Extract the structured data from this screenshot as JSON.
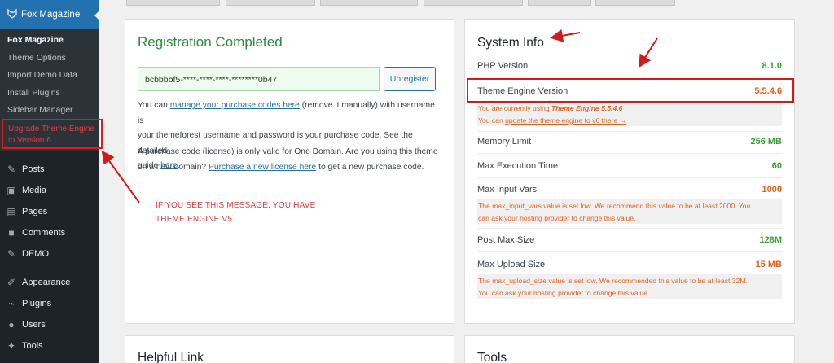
{
  "sidebar": {
    "brand": "Fox Magazine",
    "sub_items": [
      {
        "label": "Fox Magazine",
        "active": true
      },
      {
        "label": "Theme Options"
      },
      {
        "label": "Import Demo Data"
      },
      {
        "label": "Install Plugins"
      },
      {
        "label": "Sidebar Manager"
      }
    ],
    "upgrade_line1": "Upgrade Theme Engine",
    "upgrade_line2": "to Version 6",
    "menu": [
      {
        "label": "Posts",
        "icon": "pin-icon"
      },
      {
        "label": "Media",
        "icon": "media-icon"
      },
      {
        "label": "Pages",
        "icon": "page-icon"
      },
      {
        "label": "Comments",
        "icon": "comment-icon"
      },
      {
        "label": "DEMO",
        "icon": "pin-icon"
      },
      {
        "label": "Appearance",
        "icon": "brush-icon"
      },
      {
        "label": "Plugins",
        "icon": "plug-icon"
      },
      {
        "label": "Users",
        "icon": "user-icon"
      },
      {
        "label": "Tools",
        "icon": "wrench-icon"
      }
    ]
  },
  "registration": {
    "title": "Registration Completed",
    "code": "bcbbbbf5-****-****-****-********0b47",
    "unregister": "Unregister",
    "p1_a": "You can ",
    "p1_link": "manage your purchase codes here",
    "p1_b": " (remove it manually) with username is",
    "p1_line2": "your themeforest username and password is your purchase code. See the detailed",
    "p1_c": "guide ",
    "p1_link2": "here",
    "p1_end": ".",
    "p2_line1": "A purchase code (license) is only valid for One Domain. Are you using this theme",
    "p2_a": "on a new domain? ",
    "p2_link": "Purchase a new license here",
    "p2_b": " to get a new purchase code.",
    "annotation_line1": "IF YOU SEE THIS MESSAGE, YOU HAVE",
    "annotation_line2": "THEME ENGINE V5"
  },
  "system": {
    "title": "System Info",
    "php_label": "PHP Version",
    "php_value": "8.1.0",
    "engine_label": "Theme Engine Version",
    "engine_value": "5.5.4.6",
    "engine_note_a": "You are currently using ",
    "engine_note_b": "Theme Engine 5.5.4.6",
    "engine_note_c": "You can ",
    "engine_note_link": "update the theme engine to v6 there →",
    "mem_label": "Memory Limit",
    "mem_value": "256 MB",
    "exec_label": "Max Execution Time",
    "exec_value": "60",
    "vars_label": "Max Input Vars",
    "vars_value": "1000",
    "vars_note1": "The max_input_vars value is set low. We recommend this value to be at least 2000. You",
    "vars_note2": "can ask your hosting provider to change this value.",
    "post_label": "Post Max Size",
    "post_value": "128M",
    "upload_label": "Max Upload Size",
    "upload_value": "15 MB",
    "upload_note1": "The max_upload_size value is set low. We recommended this value to be at least 32M.",
    "upload_note2": "You can ask your hosting provider to change this value."
  },
  "bottom": {
    "helpful": "Helpful Link",
    "tools": "Tools"
  },
  "colors": {
    "sidebar_bg": "#1d2327",
    "accent": "#2271b1",
    "success": "#3aa13a",
    "warning": "#e5601e",
    "annotation": "#d11a1a"
  }
}
